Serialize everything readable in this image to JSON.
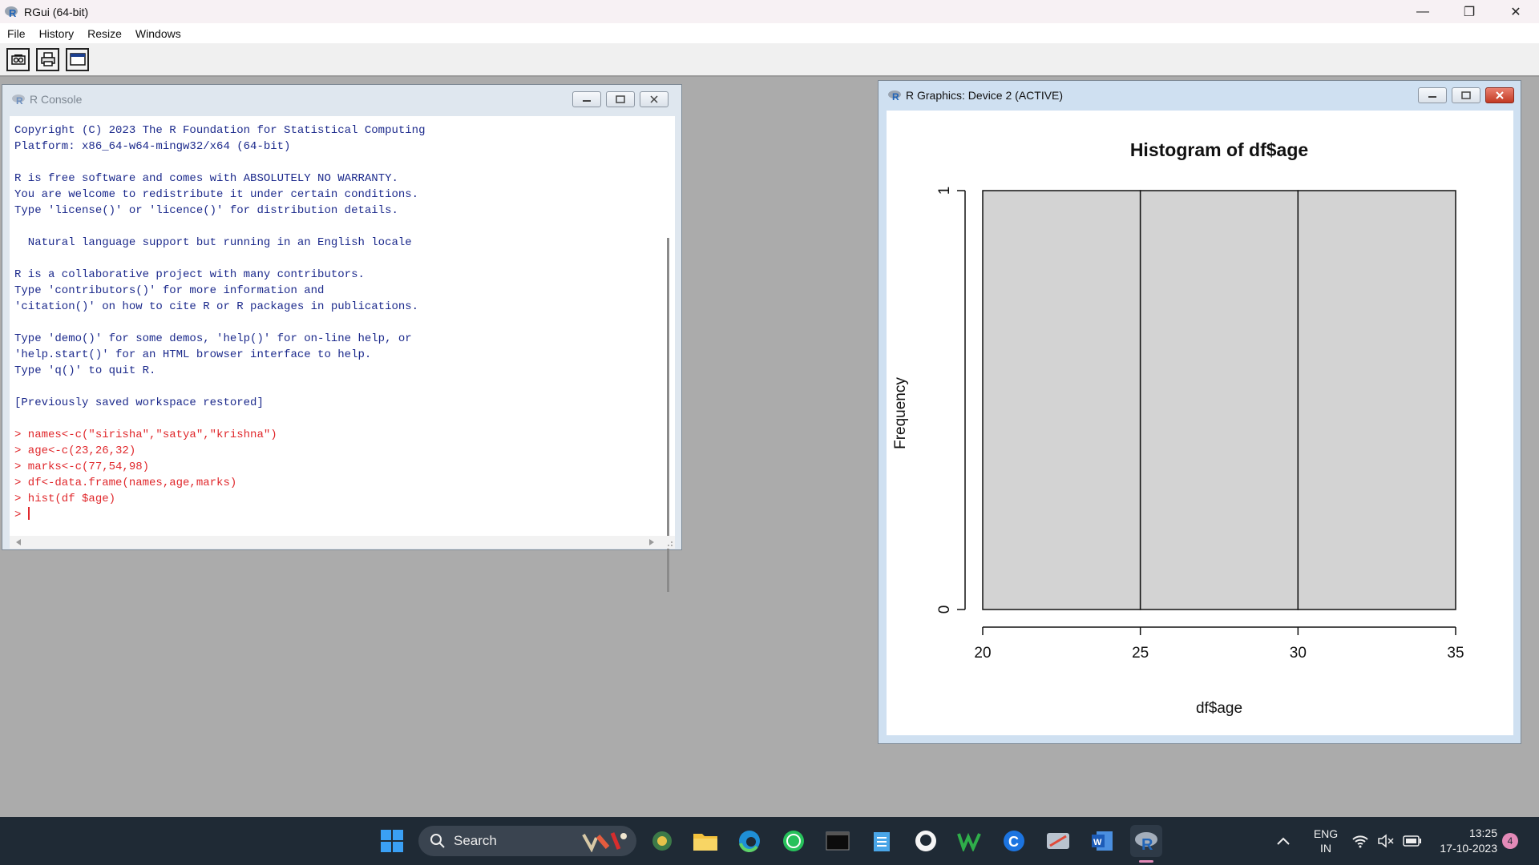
{
  "app": {
    "title": "RGui (64-bit)"
  },
  "window_controls": {
    "minimize": "—",
    "restore": "❐",
    "close": "✕"
  },
  "menu": [
    "File",
    "History",
    "Resize",
    "Windows"
  ],
  "toolbar": {
    "icons": [
      "open-script-icon",
      "print-icon",
      "window-icon"
    ]
  },
  "console": {
    "title": "R Console",
    "output_lines": [
      "Copyright (C) 2023 The R Foundation for Statistical Computing",
      "Platform: x86_64-w64-mingw32/x64 (64-bit)",
      "",
      "R is free software and comes with ABSOLUTELY NO WARRANTY.",
      "You are welcome to redistribute it under certain conditions.",
      "Type 'license()' or 'licence()' for distribution details.",
      "",
      "  Natural language support but running in an English locale",
      "",
      "R is a collaborative project with many contributors.",
      "Type 'contributors()' for more information and",
      "'citation()' on how to cite R or R packages in publications.",
      "",
      "Type 'demo()' for some demos, 'help()' for on-line help, or",
      "'help.start()' for an HTML browser interface to help.",
      "Type 'q()' to quit R.",
      "",
      "[Previously saved workspace restored]",
      ""
    ],
    "commands": [
      "> names<-c(\"sirisha\",\"satya\",\"krishna\")",
      "> age<-c(23,26,32)",
      "> marks<-c(77,54,98)",
      "> df<-data.frame(names,age,marks)",
      "> hist(df $age)"
    ],
    "prompt": "> ",
    "colors": {
      "output": "#1c2a8c",
      "command": "#e0282c"
    }
  },
  "graphics": {
    "title": "R Graphics: Device 2 (ACTIVE)"
  },
  "chart_data": {
    "type": "bar",
    "title": "Histogram of df$age",
    "xlabel": "df$age",
    "ylabel": "Frequency",
    "bins": [
      [
        20,
        25
      ],
      [
        25,
        30
      ],
      [
        30,
        35
      ]
    ],
    "values": [
      1,
      1,
      1
    ],
    "xlim": [
      20,
      35
    ],
    "ylim": [
      0,
      1
    ],
    "x_ticks": [
      "20",
      "25",
      "30",
      "35"
    ],
    "y_ticks": [
      "0",
      "1"
    ],
    "bar_color": "#d3d3d3",
    "grid": false
  },
  "taskbar": {
    "search_label": "Search",
    "language": "ENG",
    "region": "IN",
    "time": "13:25",
    "date": "17-10-2023",
    "notification_count": "4",
    "pinned": [
      "start-icon",
      "search-icon",
      "edge-beta-icon",
      "file-explorer-icon",
      "edge-icon",
      "whatsapp-icon",
      "terminal-icon",
      "notepad-icon",
      "github-icon",
      "word-online-icon",
      "ccleaner-icon",
      "r-studio-icon",
      "word-icon",
      "r-icon"
    ]
  }
}
